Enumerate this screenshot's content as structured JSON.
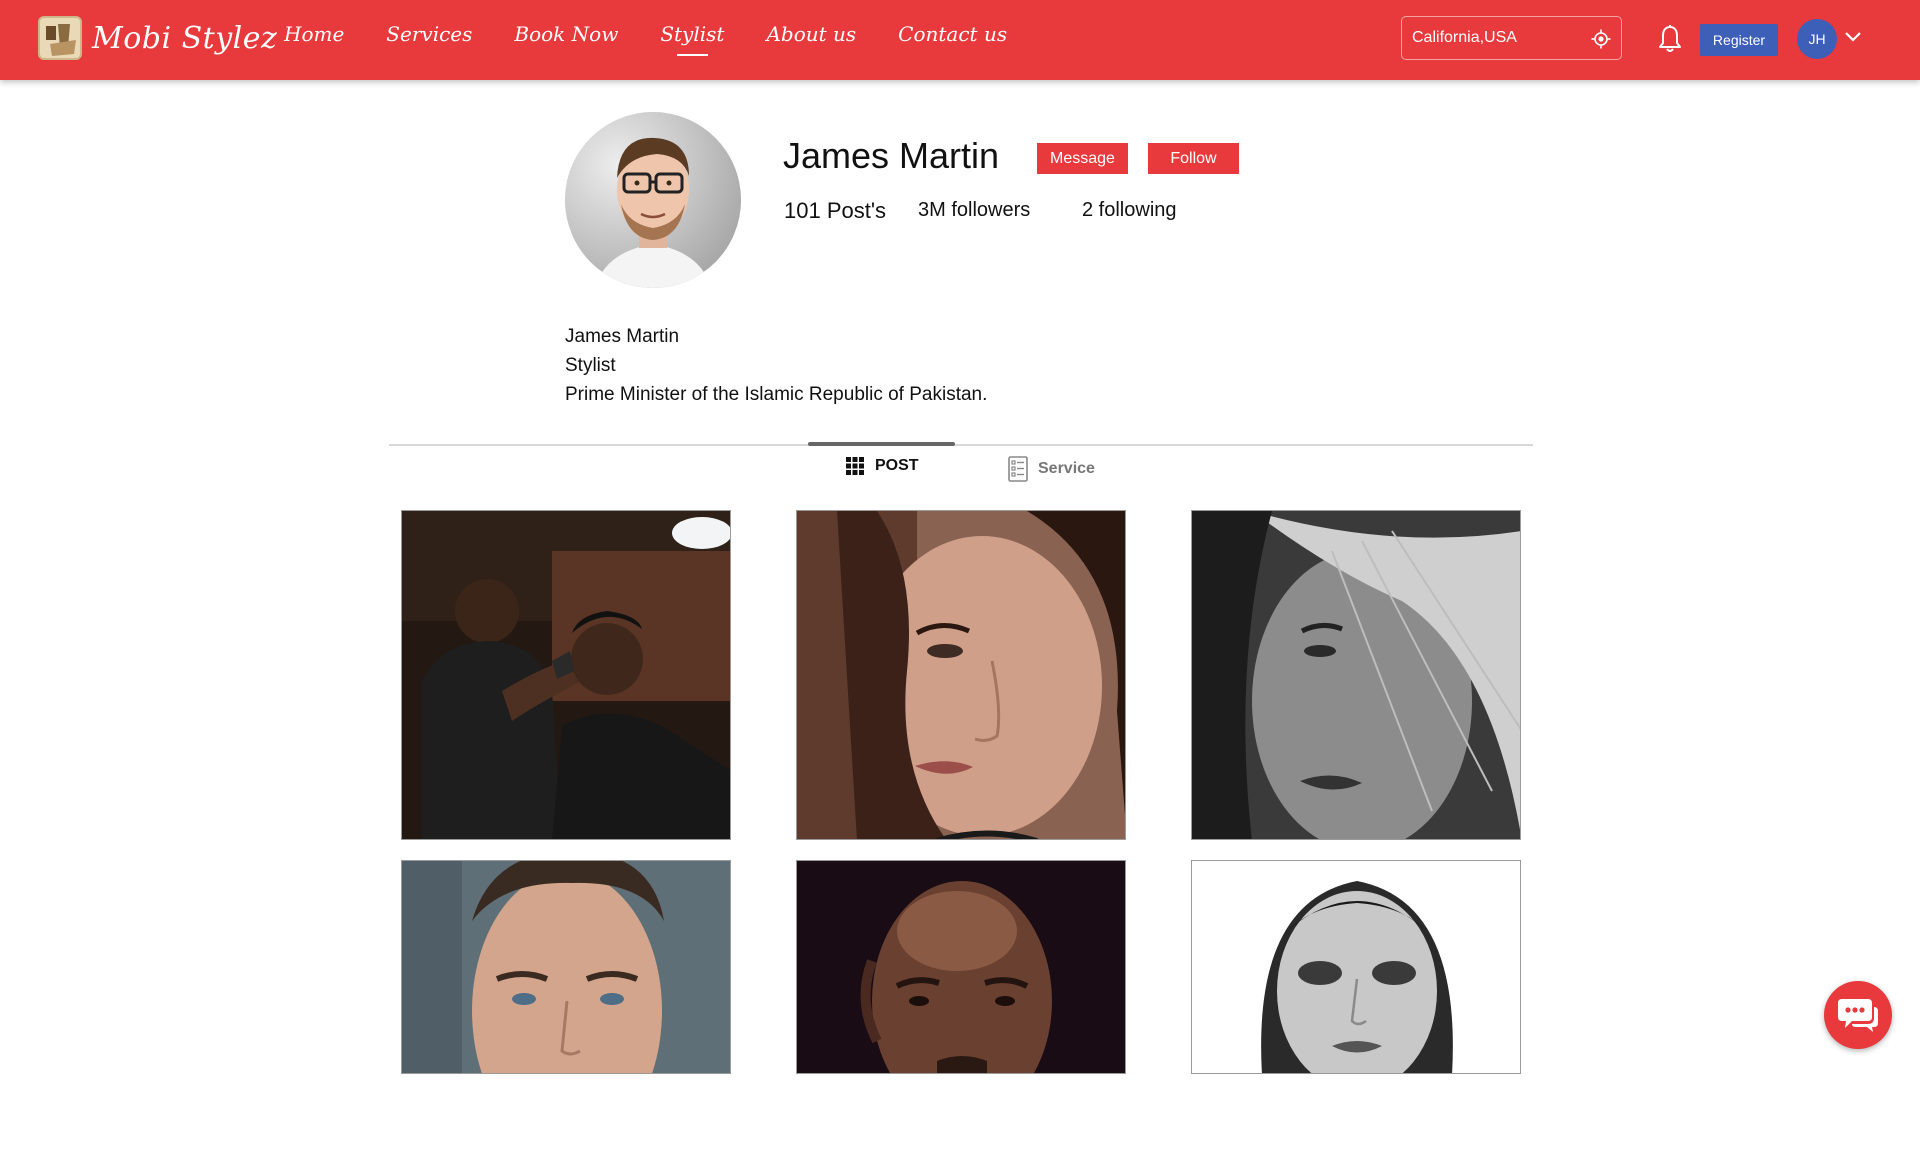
{
  "brand": {
    "name": "Mobi Stylez"
  },
  "nav": {
    "items": [
      {
        "label": "Home",
        "active": false
      },
      {
        "label": "Services",
        "active": false
      },
      {
        "label": "Book Now",
        "active": false
      },
      {
        "label": "Stylist",
        "active": true
      },
      {
        "label": "About us",
        "active": false
      },
      {
        "label": "Contact us",
        "active": false
      }
    ]
  },
  "header": {
    "location_value": "California,USA",
    "register_label": "Register",
    "user_initials": "JH"
  },
  "profile": {
    "name": "James Martin",
    "message_label": "Message",
    "follow_label": "Follow",
    "stats": {
      "posts": "101 Post's",
      "followers": "3M followers",
      "following": "2 following"
    },
    "bio": [
      "James Martin",
      "Stylist",
      "Prime Minister of the Islamic Republic of Pakistan."
    ]
  },
  "tabs": [
    {
      "label": "POST",
      "icon": "grid-icon",
      "active": true
    },
    {
      "label": "Service",
      "icon": "document-list-icon",
      "active": false
    }
  ],
  "posts": [
    {
      "subject": "barber-cutting-hair"
    },
    {
      "subject": "woman-portrait-closeup"
    },
    {
      "subject": "woman-black-and-white-hair-blowing"
    },
    {
      "subject": "man-portrait"
    },
    {
      "subject": "bald-man-portrait-dark"
    },
    {
      "subject": "woman-black-and-white-portrait"
    }
  ],
  "colors": {
    "brand_red": "#e8393c",
    "register_blue": "#3d5fb8"
  }
}
